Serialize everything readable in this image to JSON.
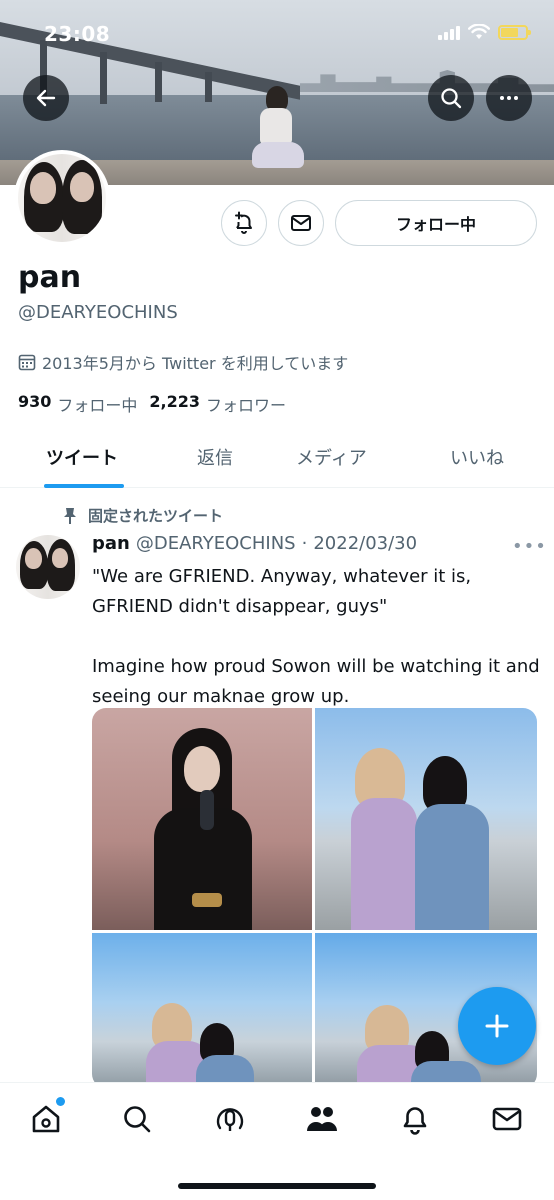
{
  "status_bar": {
    "time": "23:08"
  },
  "profile": {
    "display_name": "pan",
    "handle": "@DEARYEOCHINS",
    "joined": "2013年5月から Twitter を利用しています",
    "following_count": "930",
    "following_label": "フォロー中",
    "followers_count": "2,223",
    "followers_label": "フォロワー",
    "follow_button_label": "フォロー中"
  },
  "tabs": [
    {
      "label": "ツイート",
      "active": true
    },
    {
      "label": "返信",
      "active": false
    },
    {
      "label": "メディア",
      "active": false
    },
    {
      "label": "いいね",
      "active": false
    }
  ],
  "tweet": {
    "pinned_label": "固定されたツイート",
    "name": "pan",
    "handle": "@DEARYEOCHINS",
    "separator": "·",
    "date": "2022/03/30",
    "text": "\"We are GFRIEND. Anyway, whatever it is, GFRIEND didn't disappear, guys\"\n\nImagine how proud Sowon will be watching it and seeing our maknae grow up.",
    "more": "•••"
  },
  "icons": {
    "back": "arrow-left-icon",
    "search": "search-icon",
    "more": "more-horizontal-icon",
    "notify": "bell-plus-icon",
    "message": "mail-icon",
    "calendar": "calendar-icon",
    "pin": "pin-icon",
    "compose": "plus-icon",
    "nav": [
      "home-icon",
      "search-icon",
      "spaces-icon",
      "communities-icon",
      "bell-icon",
      "mail-icon"
    ]
  },
  "colors": {
    "accent": "#1d9bf0",
    "text_primary": "#0f1419",
    "text_secondary": "#536471",
    "border": "#cfd9de"
  }
}
